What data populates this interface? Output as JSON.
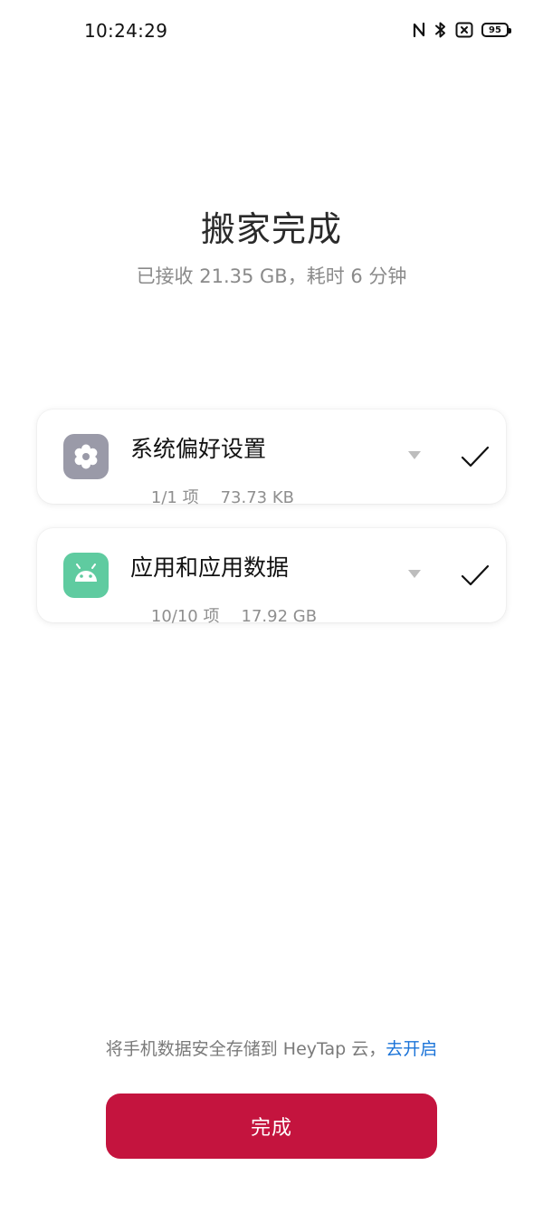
{
  "status_bar": {
    "time": "10:24:29",
    "battery_level": "95",
    "icons": [
      "nfc-icon",
      "bluetooth-icon",
      "no-sim-icon",
      "battery-icon"
    ]
  },
  "header": {
    "title": "搬家完成",
    "subtitle": "已接收 21.35 GB，耗时 6 分钟"
  },
  "items": [
    {
      "title": "系统偏好设置",
      "count": "1/1 项",
      "size": "73.73 KB",
      "icon": "settings-icon",
      "icon_color": "#9a9aa8",
      "status": "completed"
    },
    {
      "title": "应用和应用数据",
      "count": "10/10 项",
      "size": "17.92 GB",
      "icon": "android-icon",
      "icon_color": "#5fcba0",
      "status": "completed"
    }
  ],
  "footer": {
    "cloud_hint": "将手机数据安全存储到 HeyTap 云，",
    "cloud_link": "去开启",
    "done_button": "完成"
  },
  "colors": {
    "accent": "#c4143e",
    "link": "#1a73d8"
  }
}
